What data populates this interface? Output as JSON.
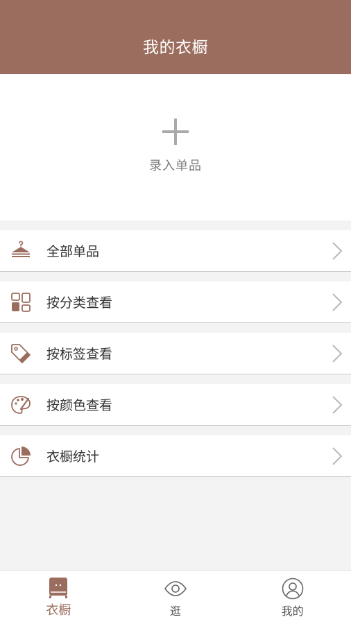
{
  "colors": {
    "accent": "#9b6d5e",
    "background": "#f3f3f3",
    "text": "#333333",
    "muted": "#7a7a7a"
  },
  "header": {
    "title": "我的衣橱"
  },
  "add_item": {
    "label": "录入单品",
    "icon": "plus-icon"
  },
  "menu": [
    {
      "label": "全部单品",
      "icon": "hanger-icon"
    },
    {
      "label": "按分类查看",
      "icon": "category-grid-icon"
    },
    {
      "label": "按标签查看",
      "icon": "tag-icon"
    },
    {
      "label": "按颜色查看",
      "icon": "palette-icon"
    },
    {
      "label": "衣橱统计",
      "icon": "pie-chart-icon"
    }
  ],
  "tabbar": [
    {
      "label": "衣橱",
      "icon": "wardrobe-icon",
      "active": true
    },
    {
      "label": "逛",
      "icon": "eye-icon",
      "active": false
    },
    {
      "label": "我的",
      "icon": "user-icon",
      "active": false
    }
  ]
}
